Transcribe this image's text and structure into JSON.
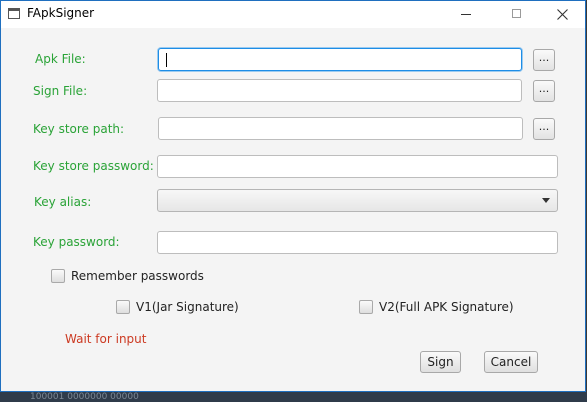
{
  "window": {
    "title": "FApkSigner"
  },
  "form": {
    "apk_label": "Apk File:",
    "apk_value": "",
    "sign_label": "Sign File:",
    "sign_value": "",
    "keystore_path_label": "Key store path:",
    "keystore_path_value": "",
    "keystore_password_label": "Key store password:",
    "keystore_password_value": "",
    "alias_label": "Key alias:",
    "alias_value": "",
    "key_password_label": "Key password:",
    "key_password_value": "",
    "browse_label": "..."
  },
  "options": {
    "remember": "Remember passwords",
    "v1": "V1(Jar Signature)",
    "v2": "V2(Full APK  Signature)"
  },
  "status": {
    "text": "Wait for input",
    "color": "#cc3a22"
  },
  "actions": {
    "sign": "Sign",
    "cancel": "Cancel"
  },
  "colors": {
    "label_green": "#2aa337",
    "focus_blue": "#1d8de6"
  },
  "background": {
    "partial_text": "100001 0000000 00000"
  }
}
